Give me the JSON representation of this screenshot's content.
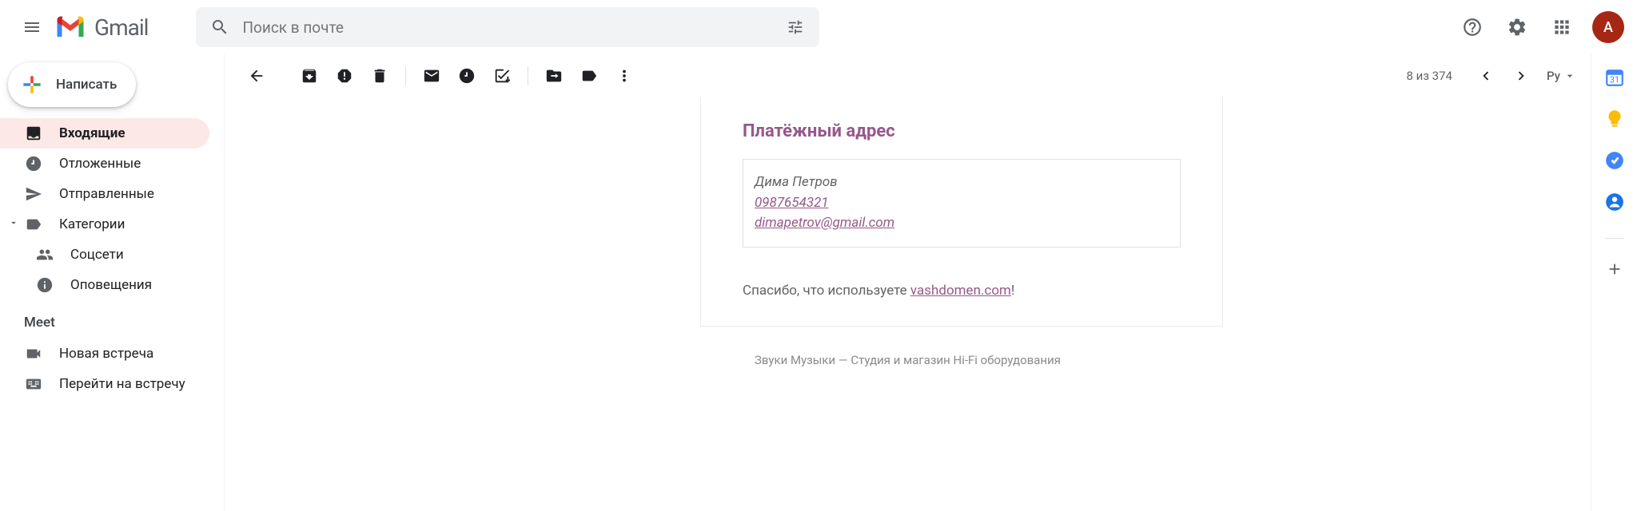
{
  "header": {
    "brand": "Gmail",
    "search_placeholder": "Поиск в почте",
    "avatar_initial": "A"
  },
  "sidebar": {
    "compose": "Написать",
    "items": [
      {
        "label": "Входящие"
      },
      {
        "label": "Отложенные"
      },
      {
        "label": "Отправленные"
      },
      {
        "label": "Категории"
      },
      {
        "label": "Соцсети"
      },
      {
        "label": "Оповещения"
      }
    ],
    "meet": {
      "header": "Meet",
      "new": "Новая встреча",
      "join": "Перейти на встречу"
    }
  },
  "toolbar": {
    "pager": "8 из 374",
    "lang": "Ру"
  },
  "email": {
    "billing_title": "Платёжный адрес",
    "name": "Дима Петров",
    "phone": "0987654321",
    "mail": "dimapetrov@gmail.com",
    "thanks_prefix": "Спасибо, что используете ",
    "thanks_link": "vashdomen.com",
    "thanks_suffix": "!",
    "footer": "Звуки Музыки — Студия и магазин Hi-Fi оборудования"
  }
}
